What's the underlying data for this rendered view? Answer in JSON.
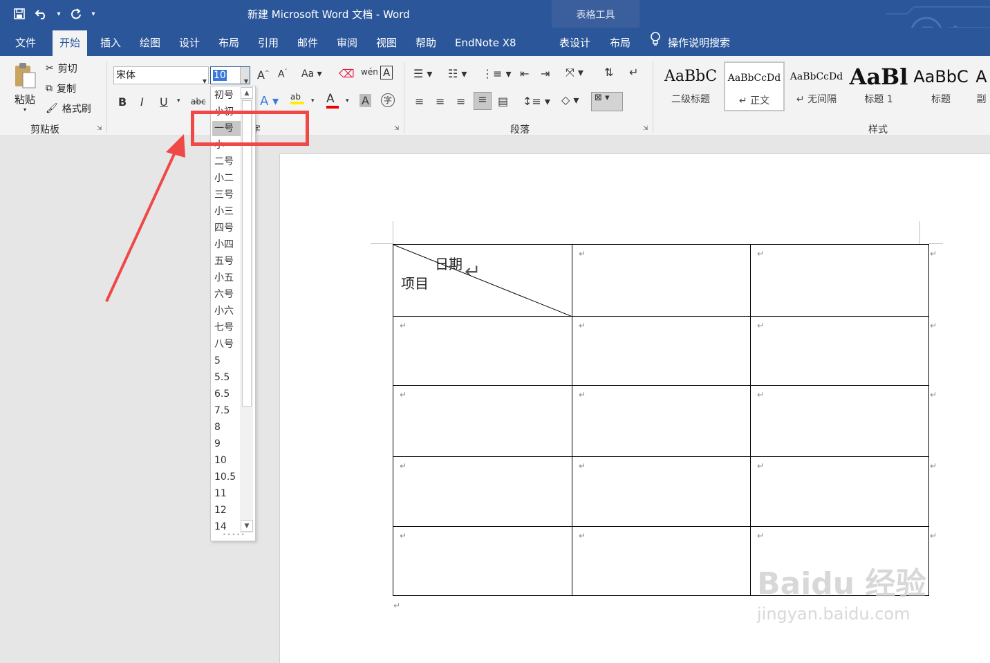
{
  "window": {
    "title": "新建 Microsoft Word 文档 - Word",
    "context_group": "表格工具"
  },
  "qat": {
    "save": "save-icon",
    "undo": "undo-icon",
    "redo": "redo-icon",
    "more": "▾"
  },
  "tabs": [
    "文件",
    "开始",
    "插入",
    "绘图",
    "设计",
    "布局",
    "引用",
    "邮件",
    "审阅",
    "视图",
    "帮助",
    "EndNote X8",
    "表设计",
    "布局"
  ],
  "active_tab": "开始",
  "search_tab": "操作说明搜索",
  "clipboard": {
    "paste": "粘贴",
    "cut": "剪切",
    "copy": "复制",
    "format_painter": "格式刷",
    "label": "剪贴板"
  },
  "font": {
    "name": "宋体",
    "size": "10",
    "bold": "B",
    "italic": "I",
    "underline": "U",
    "strike": "abc",
    "label": "字"
  },
  "paragraph": {
    "label": "段落"
  },
  "styles": {
    "label": "样式",
    "items": [
      {
        "sample": "AaBbC",
        "name": "二级标题"
      },
      {
        "sample": "AaBbCcDd",
        "name": "↵ 正文"
      },
      {
        "sample": "AaBbCcDd",
        "name": "↵ 无间隔"
      },
      {
        "sample": "AaBl",
        "name": "标题 1"
      },
      {
        "sample": "AaBbC",
        "name": "标题"
      },
      {
        "sample": "A",
        "name": "副"
      }
    ]
  },
  "size_dropdown": {
    "items": [
      "初号",
      "小初",
      "一号",
      "小一",
      "二号",
      "小二",
      "三号",
      "小三",
      "四号",
      "小四",
      "五号",
      "小五",
      "六号",
      "小六",
      "七号",
      "八号",
      "5",
      "5.5",
      "6.5",
      "7.5",
      "8",
      "9",
      "10",
      "10.5",
      "11",
      "12",
      "14"
    ],
    "selected": "一号"
  },
  "table": {
    "header_cell": {
      "top_right": "日期",
      "bottom_left": "项目"
    },
    "rows": 5,
    "cols": 3,
    "cell_mark": "↵"
  },
  "watermark": {
    "main": "Baidu 经验",
    "sub": "jingyan.baidu.com"
  },
  "colors": {
    "brand": "#2b579a",
    "ribbon": "#f3f3f3",
    "annotation": "#f04747"
  }
}
